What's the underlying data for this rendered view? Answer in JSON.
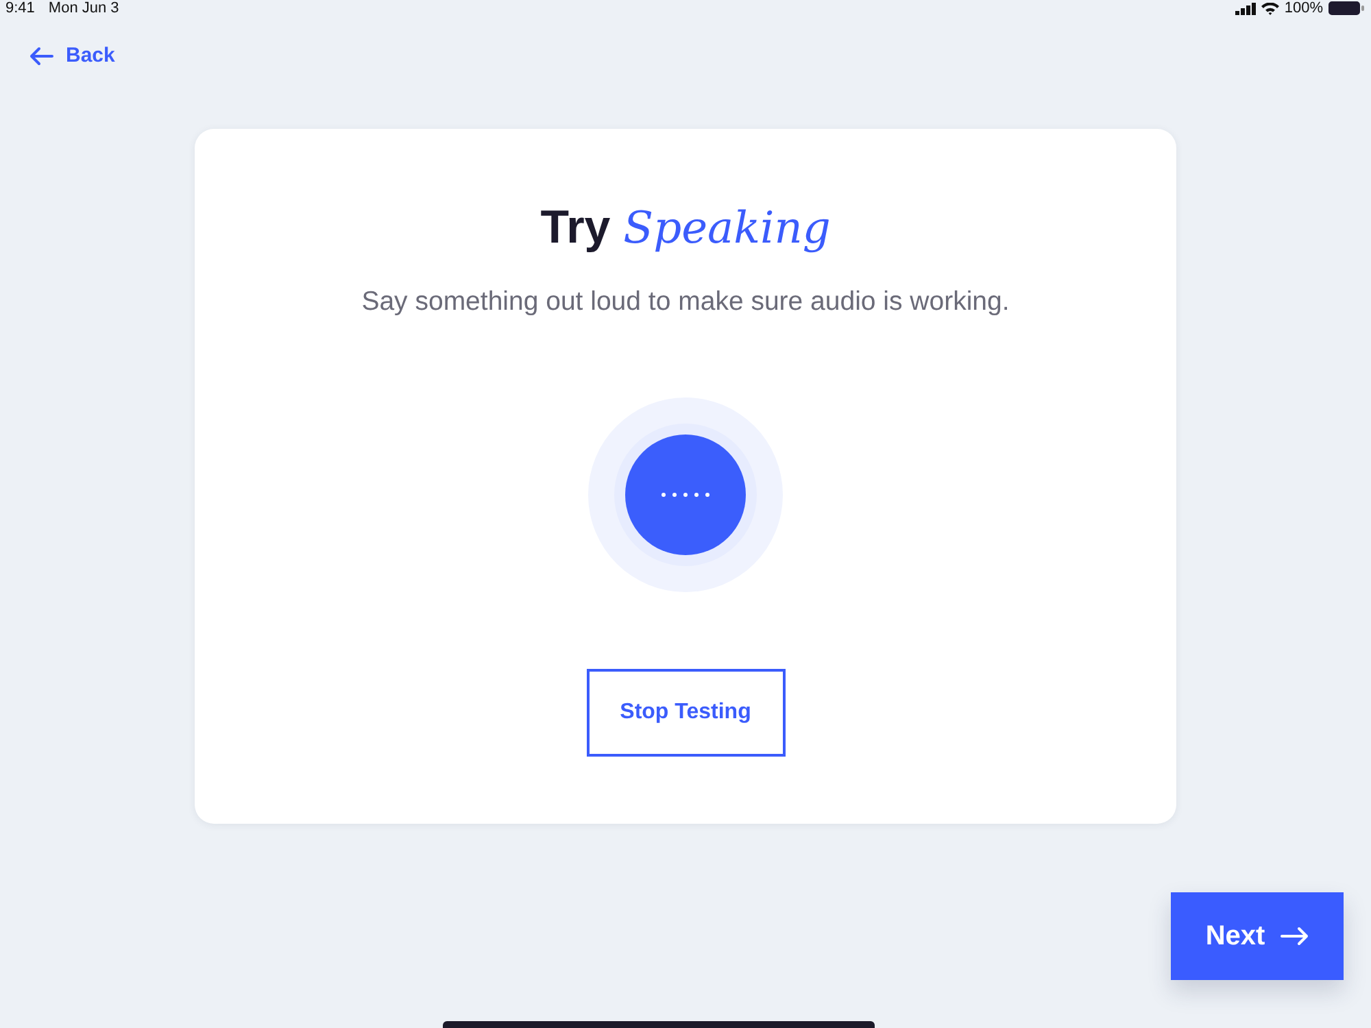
{
  "status_bar": {
    "time": "9:41",
    "date": "Mon Jun 3",
    "battery": "100%"
  },
  "back_link": {
    "label": "Back"
  },
  "card": {
    "title": "Try *Speaking*",
    "subtitle": "Say something out loud to make sure audio is working.",
    "stop_button": "Stop Testing"
  },
  "next_button": {
    "label": "Next"
  }
}
